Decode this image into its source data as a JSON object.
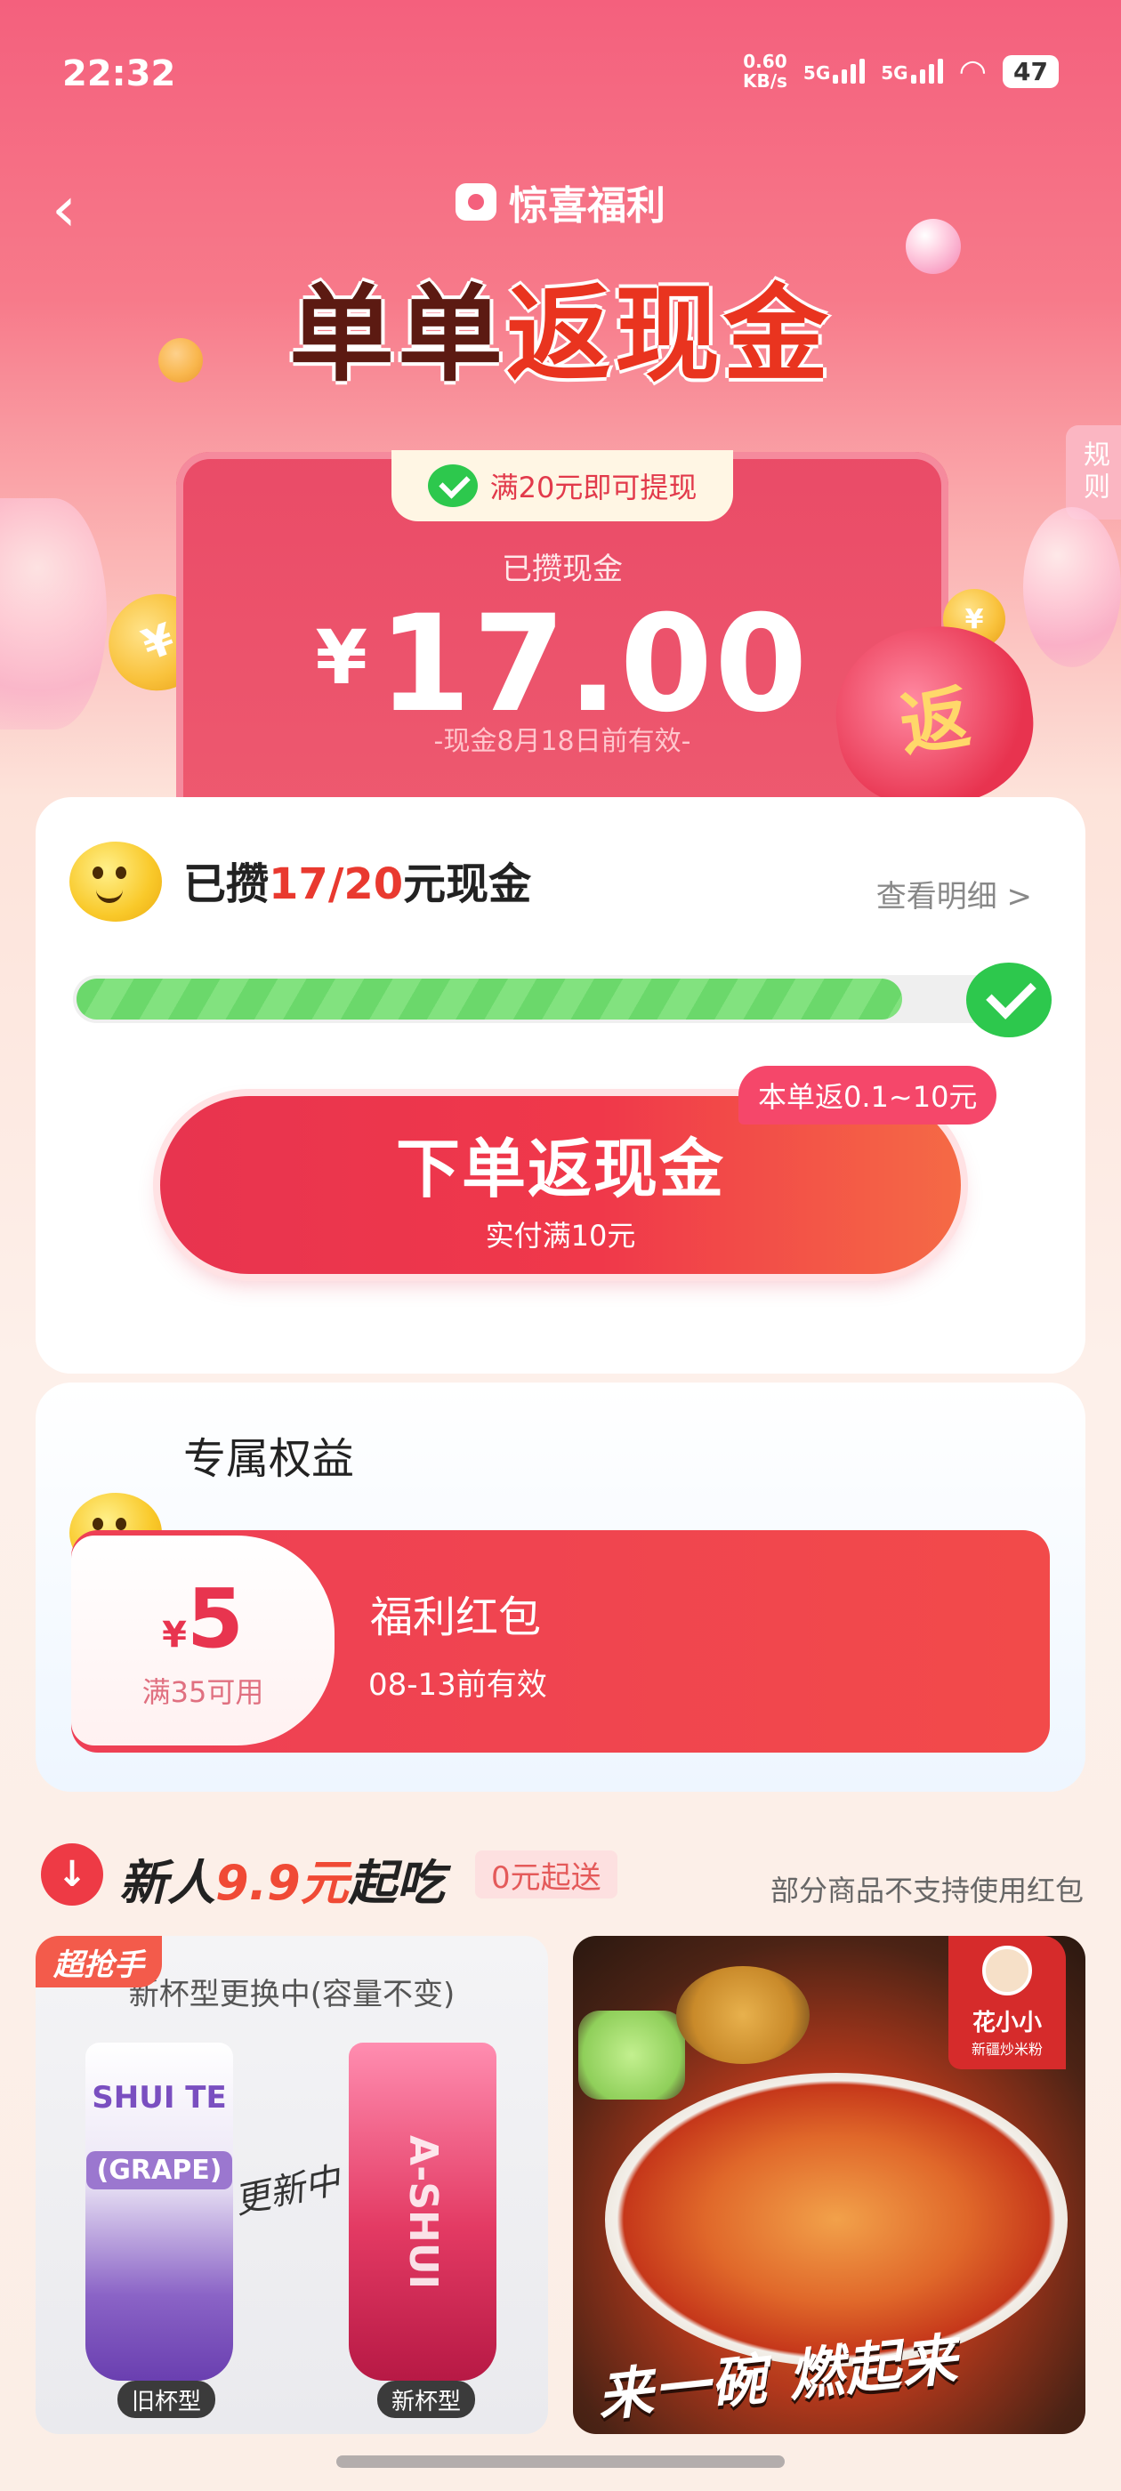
{
  "status": {
    "time": "22:32",
    "speed_value": "0.60",
    "speed_unit": "KB/s",
    "sig1": "5G",
    "sig2": "5G",
    "battery": "47"
  },
  "header": {
    "brand": "惊喜福利",
    "title_a": "单单",
    "title_b": "返现金",
    "rules": "规则"
  },
  "cash_card": {
    "badge": "满20元即可提现",
    "label": "已攒现金",
    "currency": "¥",
    "amount": "17.00",
    "validity": "-现金8月18日前有效-",
    "bag_text": "返"
  },
  "progress": {
    "title_pre": "已攒",
    "title_hl": "17/20",
    "title_post": "元现金",
    "detail_link": "查看明细 >",
    "progress_fraction": 0.85
  },
  "order_button": {
    "label": "下单返现金",
    "sub": "实付满10元",
    "tag": "本单返0.1~10元"
  },
  "benefits": {
    "title": "专属权益",
    "coupon": {
      "currency": "¥",
      "amount": "5",
      "condition": "满35可用",
      "name": "福利红包",
      "validity": "08-13前有效"
    }
  },
  "new_user": {
    "icon": "↓",
    "title_pre": "新人",
    "title_hl": "9.9元",
    "title_post": "起吃",
    "tag": "0元起送",
    "note": "部分商品不支持使用红包"
  },
  "products": [
    {
      "flash_tag": "超抢手",
      "caption": "新杯型更换中(容量不变)",
      "old_brand": "SHUI TE",
      "old_flavor": "(GRAPE)",
      "changing": "更新中",
      "new_brand": "A-SHUI",
      "old_label": "旧杯型",
      "new_label": "新杯型"
    },
    {
      "brand_name": "花小小",
      "brand_sub": "新疆炒米粉",
      "slogan": "来一碗 燃起来"
    }
  ],
  "colors": {
    "primary_red": "#e8344f",
    "progress_green": "#6bd86b",
    "wechat_green": "#2dc84d"
  }
}
